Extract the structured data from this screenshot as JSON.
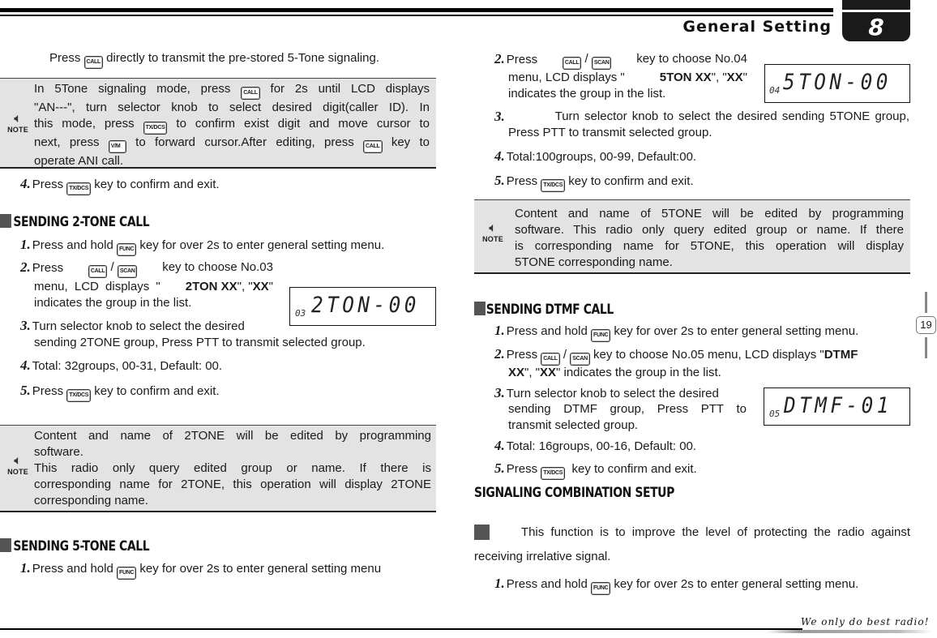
{
  "header": {
    "page_heading": "General Setting",
    "chapter_number": "8"
  },
  "keys": {
    "call": "CALL",
    "scan": "SCAN",
    "func": "FUNC",
    "txdcs": "TX/DCS",
    "vm": "V/M"
  },
  "left": {
    "intro_pre": "Press ",
    "intro_post": " directly to transmit the pre-stored 5-Tone signaling.",
    "note1": {
      "icon_label": "NOTE",
      "l1_a": "In 5Tone signaling mode, press ",
      "l1_b": " for 2s until LCD displays",
      "l2": "\"AN---\", turn selector knob to select desired digit(caller ID). In",
      "l3_a": "this mode, press ",
      "l3_b": " to confirm exist digit and move cursor to",
      "l4_a": "next, press ",
      "l4_b": " to forward cursor.After editing, press ",
      "l4_c": " key to",
      "l5": "operate ANI call."
    },
    "step4_num": "4.",
    "step4_a": "Press ",
    "step4_b": " key to confirm and exit.",
    "two_tone": {
      "title": "SENDING 2-TONE CALL",
      "s1_num": "1.",
      "s1_a": "Press and hold ",
      "s1_b": " key for over 2s to enter general setting menu.",
      "s2_num": "2.",
      "s2_a": "Press ",
      "s2_sep": " / ",
      "s2_b": " key to choose No.03",
      "s2_l2_a": "menu, LCD displays \"",
      "s2_l2_bold1": "2TON XX",
      "s2_l2_mid": "\", \"",
      "s2_l2_bold2": "XX",
      "s2_l2_end": "\"",
      "s2_l3": "indicates the group in the list.",
      "s3_num": "3.",
      "s3_l1": "Turn selector knob to select the desired",
      "s3_l2": "sending 2TONE group, Press PTT to transmit selected group.",
      "s4_num": "4.",
      "s4": "Total: 32groups, 00-31, Default: 00.",
      "s5_num": "5.",
      "s5_a": "Press ",
      "s5_b": " key to confirm and exit.",
      "lcd_menu": "03",
      "lcd_text": "2TON-00"
    },
    "note2": {
      "icon_label": "NOTE",
      "l1": "Content and name of 2TONE will be edited by programming",
      "l2": "software.",
      "l3": "This radio only query edited group or name. If there is",
      "l4": "corresponding name for 2TONE, this operation will display 2TONE",
      "l5": "corresponding name."
    },
    "five_tone": {
      "title": "SENDING 5-TONE CALL",
      "s1_num": "1.",
      "s1_a": "Press and hold ",
      "s1_b": " key for over 2s to enter general setting menu"
    }
  },
  "right": {
    "five_tone_cont": {
      "s2_num": "2.",
      "s2_a": "Press ",
      "s2_sep": " / ",
      "s2_b": " key to choose No.04",
      "s2_l2_a": "menu, LCD displays \"",
      "s2_l2_bold1": "5TON XX",
      "s2_l2_mid": "\", \"",
      "s2_l2_bold2": "XX",
      "s2_l2_end": "\"",
      "s2_l3": "indicates the group in the list.",
      "s3_num": "3.",
      "s3_l1": "Turn selector knob to select the desired sending 5TONE group,",
      "s3_l2": "Press PTT to transmit selected group.",
      "s4_num": "4.",
      "s4": "Total:100groups, 00-99, Default:00.",
      "s5_num": "5.",
      "s5_a": "Press ",
      "s5_b": " key to confirm and exit.",
      "lcd_menu": "04",
      "lcd_text": "5TON-00"
    },
    "note3": {
      "icon_label": "NOTE",
      "l1": "Content and name of 5TONE will be edited by programming",
      "l2": "software. This radio only query edited group or name. If there",
      "l3": "is corresponding name for 5TONE, this operation will display",
      "l4": "5TONE corresponding name."
    },
    "dtmf": {
      "title": "SENDING DTMF CALL",
      "s1_num": "1.",
      "s1_a": "Press and hold ",
      "s1_b": " key for over 2s to enter general setting menu.",
      "s2_num": "2.",
      "s2_a": "Press ",
      "s2_sep": " / ",
      "s2_b": " key to choose No.05 menu, LCD displays \"",
      "s2_bold1": "DTMF",
      "s2_l2_bold": "XX",
      "s2_l2_mid": "\", \"",
      "s2_l2_bold2": "XX",
      "s2_l2_end": "\" indicates the group in the list.",
      "s3_num": "3.",
      "s3_l1": "Turn selector knob to select the desired",
      "s3_l2": "sending DTMF group, Press PTT to",
      "s3_l3": "transmit selected group.",
      "s4_num": "4.",
      "s4": "Total: 16groups, 00-16, Default: 00.",
      "s5_num": "5.",
      "s5_a": "Press ",
      "s5_b": "  key to confirm and exit.",
      "lcd_menu": "05",
      "lcd_text": "DTMF-01"
    },
    "signaling": {
      "title": "SIGNALING COMBINATION SETUP",
      "intro_l1": "This function is to improve the level of protecting the radio against",
      "intro_l2": "receiving irrelative signal.",
      "s1_num": "1.",
      "s1_a": "Press and hold ",
      "s1_b": " key for over 2s to enter general setting menu."
    }
  },
  "footer": {
    "page_number": "19",
    "slogan": "We only do best radio!"
  }
}
